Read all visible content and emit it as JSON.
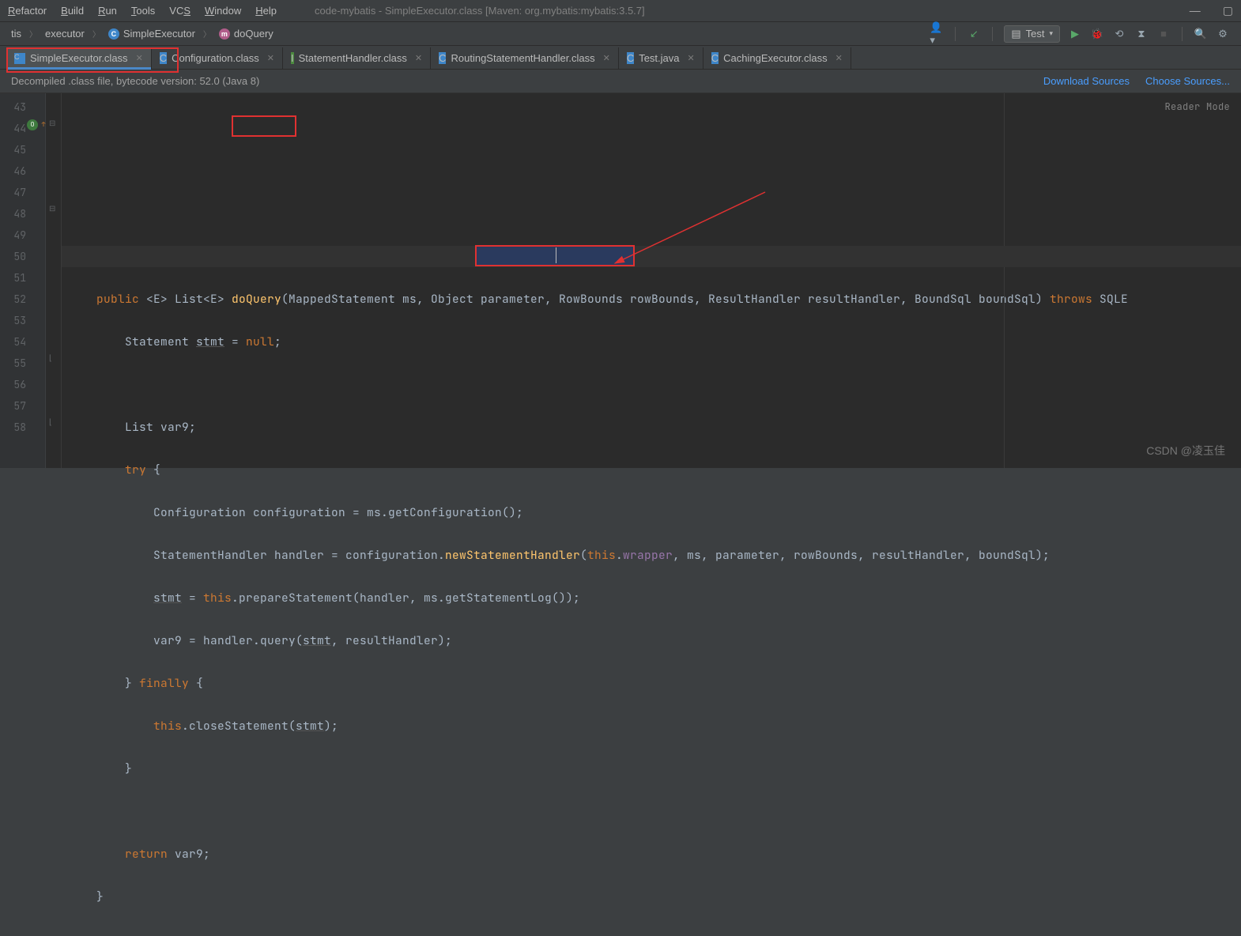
{
  "menu": {
    "items": [
      "Refactor",
      "Build",
      "Run",
      "Tools",
      "VCS",
      "Window",
      "Help"
    ]
  },
  "window_title": "code-mybatis - SimpleExecutor.class [Maven: org.mybatis:mybatis:3.5.7]",
  "breadcrumbs": {
    "a": "tis",
    "b": "executor",
    "c": "SimpleExecutor",
    "d": "doQuery"
  },
  "run_config": "Test",
  "tabs": [
    {
      "label": "SimpleExecutor.class",
      "iconColor": "c-blue",
      "active": true
    },
    {
      "label": "Configuration.class",
      "iconColor": "c-blue"
    },
    {
      "label": "StatementHandler.class",
      "iconColor": "c-green"
    },
    {
      "label": "RoutingStatementHandler.class",
      "iconColor": "c-blue"
    },
    {
      "label": "Test.java",
      "iconColor": "c-blue"
    },
    {
      "label": "CachingExecutor.class",
      "iconColor": "c-blue"
    }
  ],
  "banner": {
    "text": "Decompiled .class file, bytecode version: 52.0 (Java 8)",
    "download": "Download Sources",
    "choose": "Choose Sources..."
  },
  "reader_mode": "Reader Mode",
  "lines": {
    "start": 43,
    "count": 16
  },
  "code": {
    "sig_pre": "    public ",
    "sig_generic": "<E> ",
    "sig_ret": "List<E> ",
    "method_name": "doQuery",
    "sig_params": "(MappedStatement ms, Object parameter, RowBounds rowBounds, ResultHandler resultHandler, BoundSql boundSql) ",
    "throws_kw": "throws",
    "throws_ex": " SQLE",
    "l45_a": "        Statement ",
    "l45_b": "stmt",
    "l45_c": " = ",
    "l45_null": "null",
    "l47": "        List var9;",
    "l48_try": "        try",
    "l48_brace": " {",
    "l49": "            Configuration configuration = ms.getConfiguration();",
    "l50_a": "            StatementHandler handler = configuration.",
    "l50_call": "newStatementHandler",
    "l50_b": "(",
    "l50_this": "this",
    "l50_c": ".",
    "l50_wrapper": "wrapper",
    "l50_d": ", ms, parameter, rowBounds, resultHandler, boundSql);",
    "l51_a": "            ",
    "l51_stmt": "stmt",
    "l51_b": " = ",
    "l51_this": "this",
    "l51_c": ".prepareStatement(handler, ms.getStatementLog());",
    "l52_a": "            var9 = handler.query(",
    "l52_stmt": "stmt",
    "l52_b": ", resultHandler);",
    "l53_a": "        } ",
    "l53_fin": "finally",
    "l53_b": " {",
    "l54_a": "            ",
    "l54_this": "this",
    "l54_b": ".closeStatement(",
    "l54_stmt": "stmt",
    "l54_c": ");",
    "l55": "        }",
    "l57_a": "        ",
    "l57_ret": "return",
    "l57_b": " var9;",
    "l58": "    }"
  },
  "watermark": "CSDN @凌玉佳"
}
